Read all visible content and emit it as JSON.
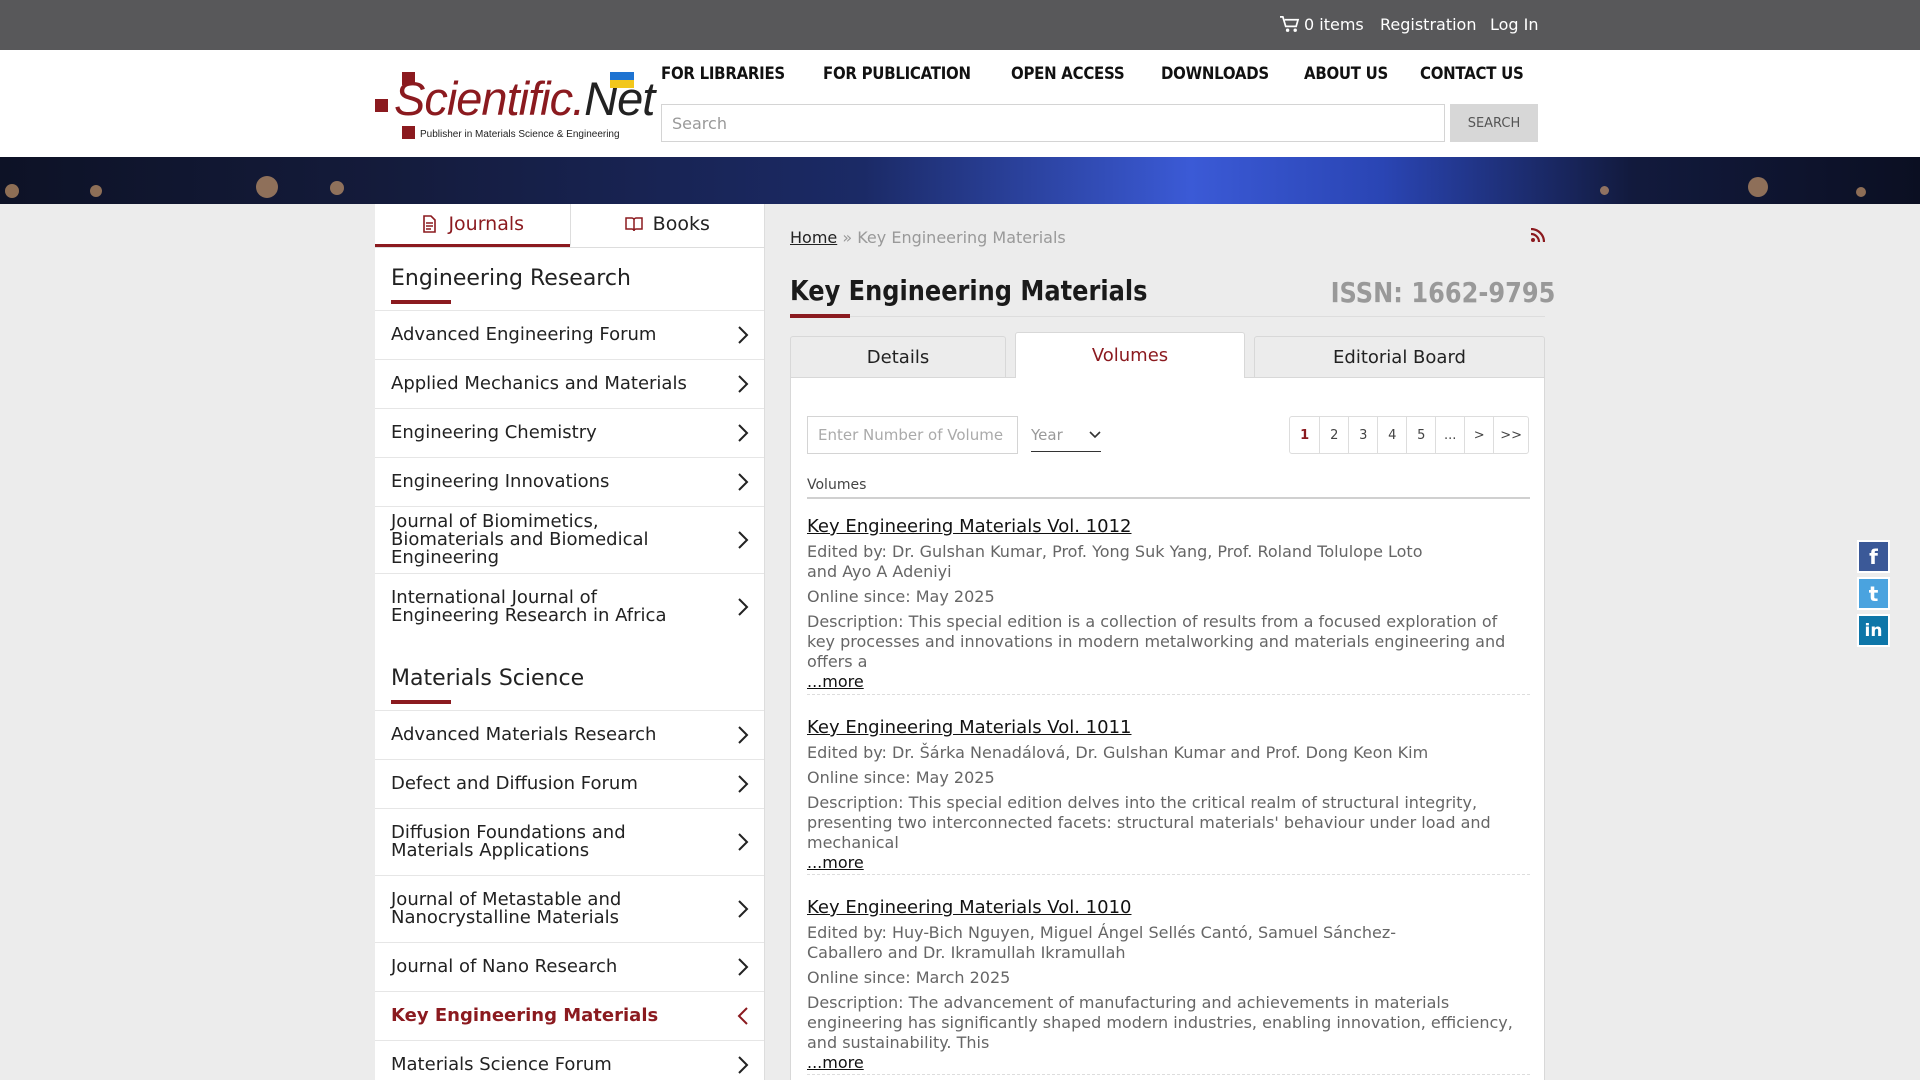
{
  "topbar": {
    "cart_label": "0 items",
    "registration": "Registration",
    "login": "Log In"
  },
  "logo": {
    "word_main": "Scientific.",
    "word_net": "Net",
    "tagline": "Publisher in Materials Science & Engineering"
  },
  "nav": {
    "items": [
      "FOR LIBRARIES",
      "FOR PUBLICATION",
      "OPEN ACCESS",
      "DOWNLOADS",
      "ABOUT US",
      "CONTACT US"
    ]
  },
  "search": {
    "placeholder": "Search",
    "button": "SEARCH"
  },
  "sidebar": {
    "tabs": [
      {
        "label": "Journals",
        "icon": "document-icon"
      },
      {
        "label": "Books",
        "icon": "book-icon"
      }
    ],
    "sections": [
      {
        "title": "Engineering Research",
        "items": [
          "Advanced Engineering Forum",
          "Applied Mechanics and Materials",
          "Engineering Chemistry",
          "Engineering Innovations",
          "Journal of Biomimetics, Biomaterials and Biomedical Engineering",
          "International Journal of Engineering Research in Africa"
        ]
      },
      {
        "title": "Materials Science",
        "items": [
          "Advanced Materials Research",
          "Defect and Diffusion Forum",
          "Diffusion Foundations and Materials Applications",
          "Journal of Metastable and Nanocrystalline Materials",
          "Journal of Nano Research",
          "Key Engineering Materials",
          "Materials Science Forum"
        ]
      }
    ]
  },
  "breadcrumb": {
    "home": "Home",
    "separator": "»",
    "current": "Key Engineering Materials"
  },
  "page": {
    "title": "Key Engineering Materials",
    "issn": "ISSN: 1662-9795"
  },
  "tabs": [
    "Details",
    "Volumes",
    "Editorial Board"
  ],
  "filters": {
    "volume_placeholder": "Enter Number of Volume",
    "year_placeholder": "Year"
  },
  "pager": [
    "1",
    "2",
    "3",
    "4",
    "5",
    "...",
    ">",
    ">>"
  ],
  "volumes_label": "Volumes",
  "volumes": [
    {
      "title": "Key Engineering Materials Vol. 1012",
      "edited_by": "Edited by: Dr. Gulshan Kumar, Prof. Yong Suk Yang, Prof. Roland Tolulope Loto and Ayo A Adeniyi",
      "online_since": "Online since: May 2025",
      "description": "Description: This special edition is a collection of results from a focused exploration of key processes and innovations in modern metalworking and materials engineering and offers a",
      "more": "...more"
    },
    {
      "title": "Key Engineering Materials Vol. 1011",
      "edited_by": "Edited by: Dr. Šárka Nenadálová, Dr. Gulshan Kumar and Prof. Dong Keon Kim",
      "online_since": "Online since: May 2025",
      "description": "Description: This special edition delves into the critical realm of structural integrity, presenting two interconnected facets: structural materials' behaviour under load and mechanical",
      "more": "...more"
    },
    {
      "title": "Key Engineering Materials Vol. 1010",
      "edited_by": "Edited by: Huy-Bich Nguyen, Miguel Ángel Sellés Cantó, Samuel Sánchez-Caballero and Dr. Ikramullah Ikramullah",
      "online_since": "Online since: March 2025",
      "description": "Description: The advancement of manufacturing and achievements in materials engineering has significantly shaped modern industries, enabling innovation, efficiency, and sustainability. This",
      "more": "...more"
    }
  ],
  "social": [
    {
      "label": "f",
      "icon": "facebook-icon",
      "color": "#3b5998"
    },
    {
      "label": "t",
      "icon": "twitter-icon",
      "color": "#4aa3df"
    },
    {
      "label": "in",
      "icon": "linkedin-icon",
      "color": "#0e76a8"
    }
  ],
  "colors": {
    "brand": "#8b1a1f",
    "topbar": "#58585a"
  }
}
